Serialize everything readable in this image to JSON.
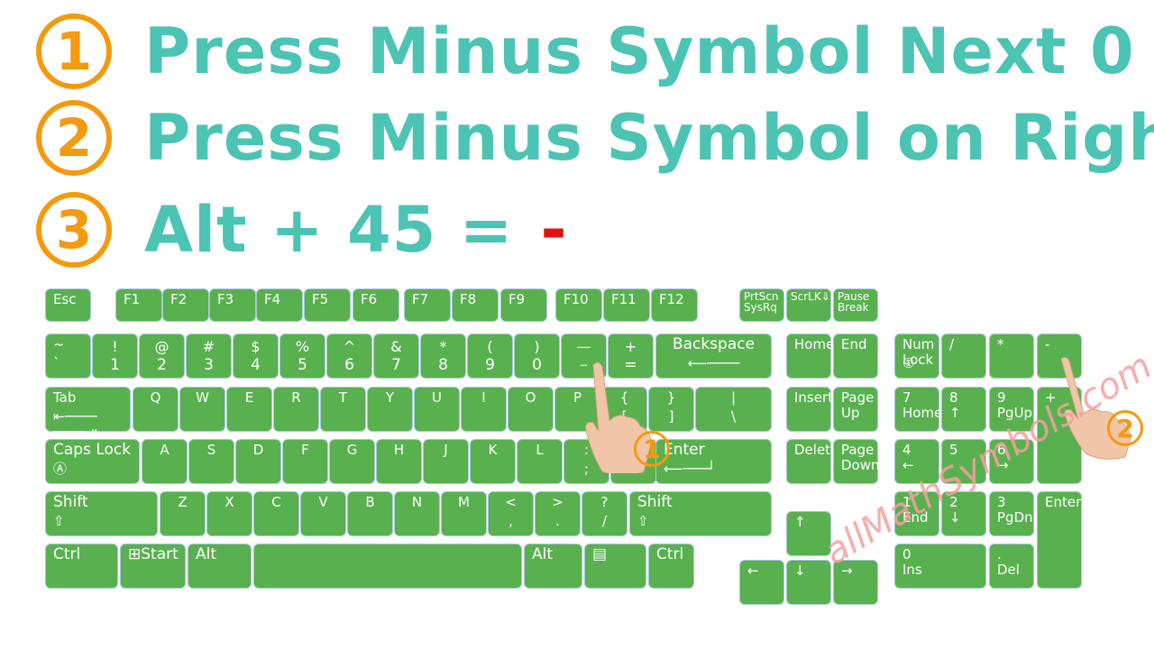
{
  "steps": [
    {
      "number": "1",
      "text": "Press Minus Symbol Next 0"
    },
    {
      "number": "2",
      "text": "Press Minus Symbol on Right"
    },
    {
      "number": "3",
      "text": "Alt + 45 =",
      "result": "-"
    }
  ],
  "colors": {
    "key": "#58b14e",
    "title": "#4cc4b4",
    "accent": "#f39a0e",
    "result": "#e41010",
    "watermark": "#f6a0a0"
  },
  "keys": [
    [
      "Esc",
      ""
    ],
    [
      "F1",
      ""
    ],
    [
      "F2",
      ""
    ],
    [
      "F3",
      ""
    ],
    [
      "F4",
      ""
    ],
    [
      "F5",
      ""
    ],
    [
      "F6",
      ""
    ],
    [
      "F7",
      ""
    ],
    [
      "F8",
      ""
    ],
    [
      "F9",
      ""
    ],
    [
      "F10",
      ""
    ],
    [
      "F11",
      ""
    ],
    [
      "F12",
      ""
    ],
    [
      "PrtScn\nSysRq",
      ""
    ],
    [
      "ScrLK⇓",
      ""
    ],
    [
      "Pause\nBreak",
      ""
    ],
    [
      "~",
      "`"
    ],
    [
      "!",
      "1"
    ],
    [
      "@",
      "2"
    ],
    [
      "#",
      "3"
    ],
    [
      "$",
      "4"
    ],
    [
      "%",
      "5"
    ],
    [
      "^",
      "6"
    ],
    [
      "&",
      "7"
    ],
    [
      "*",
      "8"
    ],
    [
      "(",
      "9"
    ],
    [
      ")",
      "0"
    ],
    [
      "—",
      "–"
    ],
    [
      "+",
      "="
    ],
    [
      "Backspace",
      "⟵────"
    ],
    [
      "Tab",
      "⇤────\n────⇥"
    ],
    [
      "Q",
      ""
    ],
    [
      "W",
      ""
    ],
    [
      "E",
      ""
    ],
    [
      "R",
      ""
    ],
    [
      "T",
      ""
    ],
    [
      "Y",
      ""
    ],
    [
      "U",
      ""
    ],
    [
      "I",
      ""
    ],
    [
      "O",
      ""
    ],
    [
      "P",
      ""
    ],
    [
      "{",
      "["
    ],
    [
      "}",
      "]"
    ],
    [
      "|",
      "\\"
    ],
    [
      "Caps Lock",
      "Ⓐ"
    ],
    [
      "A",
      ""
    ],
    [
      "S",
      ""
    ],
    [
      "D",
      ""
    ],
    [
      "F",
      ""
    ],
    [
      "G",
      ""
    ],
    [
      "H",
      ""
    ],
    [
      "J",
      ""
    ],
    [
      "K",
      ""
    ],
    [
      "L",
      ""
    ],
    [
      ":",
      ";"
    ],
    [
      "\"",
      "'"
    ],
    [
      "Enter",
      "⟵───┘"
    ],
    [
      "Shift",
      "⇧"
    ],
    [
      "Z",
      ""
    ],
    [
      "X",
      ""
    ],
    [
      "C",
      ""
    ],
    [
      "V",
      ""
    ],
    [
      "B",
      ""
    ],
    [
      "N",
      ""
    ],
    [
      "M",
      ""
    ],
    [
      "<",
      ","
    ],
    [
      ">",
      "."
    ],
    [
      "?",
      "/"
    ],
    [
      "Shift",
      "⇧"
    ],
    [
      "Ctrl",
      ""
    ],
    [
      "⊞Start",
      ""
    ],
    [
      "Alt",
      ""
    ],
    [
      "",
      ""
    ],
    [
      "Alt",
      ""
    ],
    [
      "▤",
      ""
    ],
    [
      "Ctrl",
      ""
    ],
    [
      "Home",
      ""
    ],
    [
      "End",
      ""
    ],
    [
      "Insert",
      ""
    ],
    [
      "Page\nUp",
      ""
    ],
    [
      "Delete",
      ""
    ],
    [
      "Page\nDown",
      ""
    ],
    [
      "↑",
      ""
    ],
    [
      "←",
      ""
    ],
    [
      "↓",
      ""
    ],
    [
      "→",
      ""
    ],
    [
      "Num\nLock",
      "①"
    ],
    [
      "/",
      ""
    ],
    [
      "*",
      ""
    ],
    [
      "-",
      ""
    ],
    [
      "7\nHome",
      ""
    ],
    [
      "8\n↑",
      ""
    ],
    [
      "9\nPgUp",
      ""
    ],
    [
      "+",
      ""
    ],
    [
      "4\n←",
      ""
    ],
    [
      "5",
      ""
    ],
    [
      "6\n→",
      ""
    ],
    [
      "1\nEnd",
      ""
    ],
    [
      "2\n↓",
      ""
    ],
    [
      "3\nPgDn",
      ""
    ],
    [
      "Enter",
      ""
    ],
    [
      "0\nIns",
      ""
    ],
    [
      ".\nDel",
      ""
    ]
  ],
  "markers": {
    "hand1": "1",
    "hand2": "2"
  },
  "watermark": "allMathSymbols.com"
}
